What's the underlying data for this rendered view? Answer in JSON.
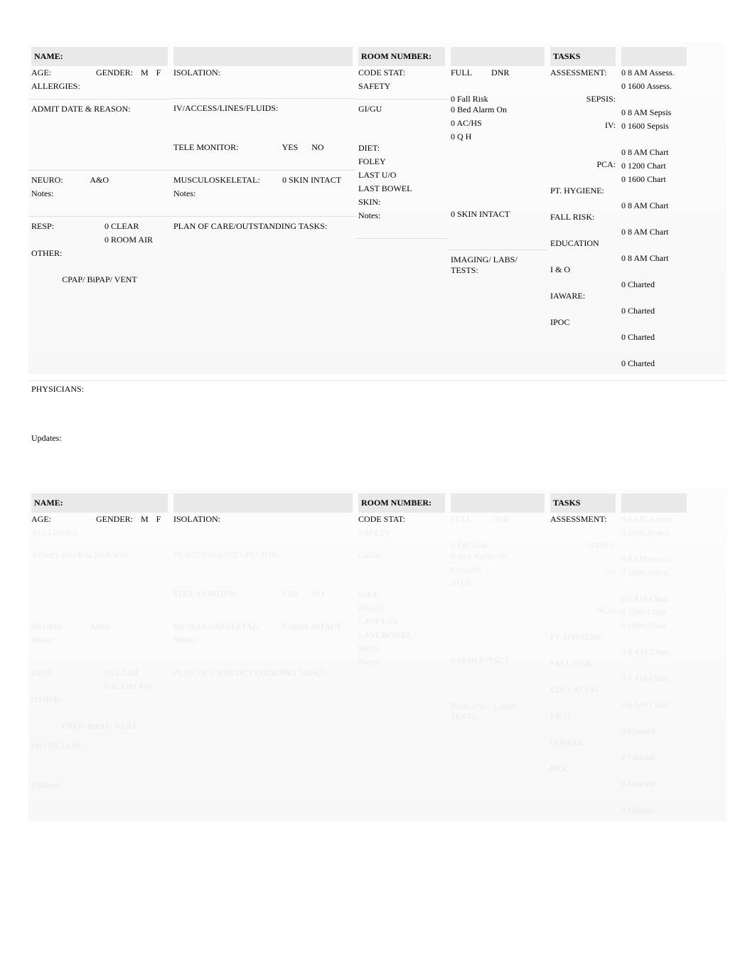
{
  "card1": {
    "header": {
      "name_label": "NAME:",
      "room_label": "ROOM NUMBER:",
      "tasks_label": "TASKS"
    },
    "left": {
      "age_label": "AGE:",
      "gender_label": "GENDER:",
      "gender_m": "M",
      "gender_f": "F",
      "allergies_label": "ALLERGIES:",
      "admit_label": "ADMIT DATE & REASON:",
      "neuro_label": "NEURO:",
      "neuro_val": "A&O",
      "notes_label": "Notes:",
      "resp_label": "RESP:",
      "resp_clear": "0 CLEAR",
      "resp_roomair": "0 ROOM AIR",
      "other_label": "OTHER:",
      "cpap_label": "CPAP/ BiPAP/ VENT"
    },
    "mid": {
      "isolation_label": "ISOLATION:",
      "iv_label": "IV/ACCESS/LINES/FLUIDS:",
      "tele_label": "TELE MONITOR:",
      "tele_yes": "YES",
      "tele_no": "NO",
      "musculo_label": "MUSCULOSKELETAL:",
      "skin_intact": "0 SKIN INTACT",
      "notes_label": "Notes:",
      "plan_label": "PLAN OF CARE/OUTSTANDING TASKS:"
    },
    "center": {
      "code_label": "CODE STAT:",
      "safety_label": "SAFETY",
      "gigu_label": "GI/GU",
      "diet_label": "DIET:",
      "foley_label": "FOLEY",
      "lastuo_label": "LAST U/O",
      "lastbowel_label": "LAST BOWEL",
      "skin_label": "SKIN:",
      "notes_label": "Notes:"
    },
    "centerR": {
      "full": "FULL",
      "dnr": "DNR",
      "fallrisk": "0 Fall Risk",
      "bedalarm": "0 Bed Alarm On",
      "achs": "0 AC/HS",
      "qh": "0 Q     H",
      "skin_intact": "0 SKIN INTACT",
      "imaging_label": "IMAGING/ LABS/ TESTS:"
    },
    "tasks": {
      "assessment_label": "ASSESSMENT:",
      "sepsis_label": "SEPSIS:",
      "iv_label": "IV:",
      "pca_label": "PCA:",
      "pthygiene_label": "PT. HYGIENE:",
      "fallrisk_label": "FALL RISK:",
      "education_label": "EDUCATION",
      "io_label": "I & O",
      "iaware_label": "IAWARE:",
      "ipoc_label": "IPOC"
    },
    "task_status": {
      "assess8": "0 8 AM Assess.",
      "assess16": "0 1600 Assess.",
      "sepsis8": "0 8 AM Sepsis",
      "sepsis16": "0 1600 Sepsis",
      "iv8": "0 8 AM Chart",
      "iv12": "0 1200 Chart",
      "iv16": "0 1600 Chart",
      "pca8": "0 8 AM Chart",
      "hyg8": "0 8 AM Chart",
      "fall8": "0 8 AM Chart",
      "edu": "0 Charted",
      "io": "0 Charted",
      "iaware": "0 Charted",
      "ipoc": "0 Charted"
    },
    "footer": {
      "physicians_label": "PHYSICIANS:",
      "updates_label": "Updates:"
    }
  },
  "card2": {
    "header": {
      "name_label": "NAME:",
      "room_label": "ROOM NUMBER:",
      "tasks_label": "TASKS"
    },
    "visible": {
      "age_label": "AGE:",
      "gender_label": "GENDER:",
      "gender_m": "M",
      "gender_f": "F",
      "isolation_label": "ISOLATION:",
      "code_label": "CODE STAT:",
      "assessment_label": "ASSESSMENT:"
    }
  }
}
